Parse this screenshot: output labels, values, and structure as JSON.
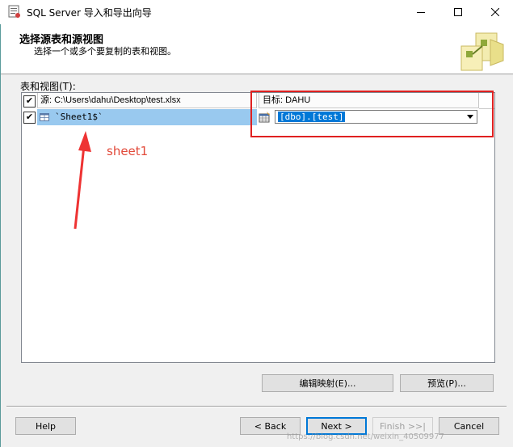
{
  "window": {
    "title": "SQL Server 导入和导出向导"
  },
  "header": {
    "title": "选择源表和源视图",
    "subtitle": "选择一个或多个要复制的表和视图。"
  },
  "tables": {
    "label": "表和视图(T):",
    "source_column": "源: C:\\Users\\dahu\\Desktop\\test.xlsx",
    "dest_column": "目标: DAHU",
    "header_checked": "✔",
    "rows": [
      {
        "checked": "✔",
        "source": "`Sheet1$`",
        "destination": "[dbo].[test]"
      }
    ]
  },
  "annotation": {
    "text": "sheet1",
    "color": "#e24a3a"
  },
  "buttons": {
    "edit_mappings": "编辑映射(E)...",
    "preview": "预览(P)...",
    "help": "Help",
    "back": "< Back",
    "next": "Next >",
    "finish": "Finish >>|",
    "cancel": "Cancel"
  },
  "watermark": "https://blog.csdn.net/weixin_40509977",
  "colors": {
    "selection": "#99c9ef",
    "highlight": "#0078d7",
    "annotation_box": "#e02020"
  }
}
